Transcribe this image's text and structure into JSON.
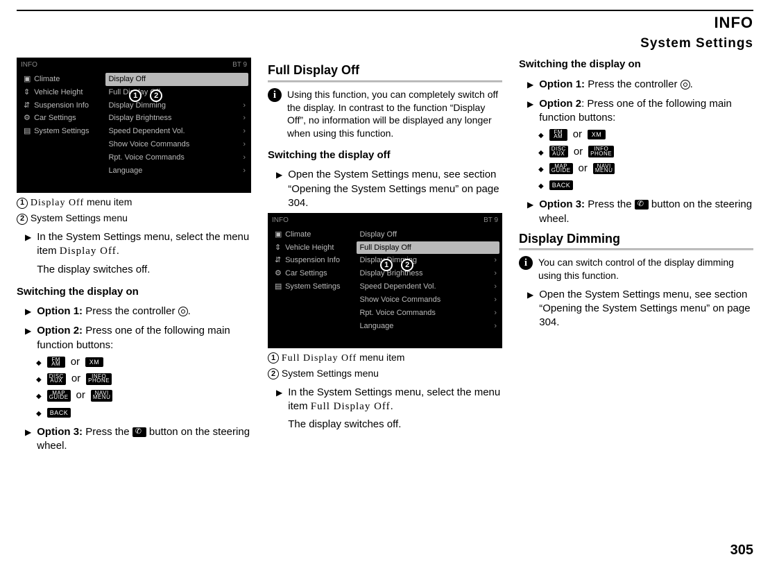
{
  "header": {
    "category": "INFO",
    "title": "System Settings"
  },
  "page_number": "305",
  "screenshot1": {
    "top_left": "INFO",
    "top_right": "BT 9",
    "left_items": [
      "Climate",
      "Vehicle Height",
      "Suspension Info",
      "Car Settings",
      "System Settings"
    ],
    "right_items": [
      "Display Off",
      "Full Display Off",
      "Display Dimming",
      "Display Brightness",
      "Speed Dependent Vol.",
      "Show Voice Commands",
      "Rpt. Voice Commands",
      "Language"
    ],
    "selected_right": 0,
    "callouts_top_index": 1
  },
  "screenshot2": {
    "top_left": "INFO",
    "top_right": "BT 9",
    "left_items": [
      "Climate",
      "Vehicle Height",
      "Suspension Info",
      "Car Settings",
      "System Settings"
    ],
    "right_items": [
      "Display Off",
      "Full Display Off",
      "Display Dimming",
      "Display Brightness",
      "Speed Dependent Vol.",
      "Show Voice Commands",
      "Rpt. Voice Commands",
      "Language"
    ],
    "selected_right": 1,
    "callouts_top_index": 2
  },
  "captions": {
    "c1a_num": "1",
    "c1a_name": "Display Off",
    "c1a_suffix": " menu item",
    "c1b_num": "2",
    "c1b_text": "System Settings menu",
    "c2a_num": "1",
    "c2a_name": "Full Display Off",
    "c2a_suffix": " menu item",
    "c2b_num": "2",
    "c2b_text": "System Settings menu"
  },
  "col1": {
    "step1a": "In the System Settings menu, select the menu item ",
    "step1a_name": "Display Off",
    "step1a_end": ".",
    "step1b": "The display switches off.",
    "h_switch_on": "Switching the display on",
    "opt1_bold": "Option 1:",
    "opt1_rest": " Press the controller ",
    "opt2_bold": "Option 2:",
    "opt2_rest": " Press one of the following main function buttons:",
    "or": " or ",
    "btn_fmam_a": "FM",
    "btn_fmam_b": "AM",
    "btn_xm": "XM",
    "btn_disc_a": "DISC",
    "btn_disc_b": "AUX",
    "btn_info_a": "INFO",
    "btn_info_b": "PHONE",
    "btn_map_a": "MAP",
    "btn_map_b": "GUIDE",
    "btn_navi_a": "NAVI",
    "btn_navi_b": "MENU",
    "btn_back": "BACK",
    "opt3_bold": "Option 3:",
    "opt3_rest_a": " Press the ",
    "opt3_rest_b": " button on the steering wheel."
  },
  "col2": {
    "h_full_off": "Full Display Off",
    "note": "Using this function, you can completely switch off the display. In contrast to the function “Display Off”, no information will be displayed any longer when using this function.",
    "h_switch_off": "Switching the display off",
    "step_open": "Open the System Settings menu, see section “Opening the System Settings menu” on page 304.",
    "step2a": "In the System Settings menu, select the menu item ",
    "step2a_name": "Full Display Off",
    "step2a_end": ".",
    "step2b": "The display switches off."
  },
  "col3": {
    "h_switch_on": "Switching the display on",
    "opt1_bold": "Option 1:",
    "opt1_rest": " Press the controller ",
    "opt2_bold": "Option 2",
    "opt2_rest": ": Press one of the following main function buttons:",
    "opt3_bold": "Option 3:",
    "opt3_rest_a": " Press the ",
    "opt3_rest_b": " button on the steering wheel.",
    "h_dimming": "Display Dimming",
    "note_dim": "You can switch control of the display dimming using this function.",
    "step_open": "Open the System Settings menu, see section “Opening the System Settings menu” on page 304."
  }
}
